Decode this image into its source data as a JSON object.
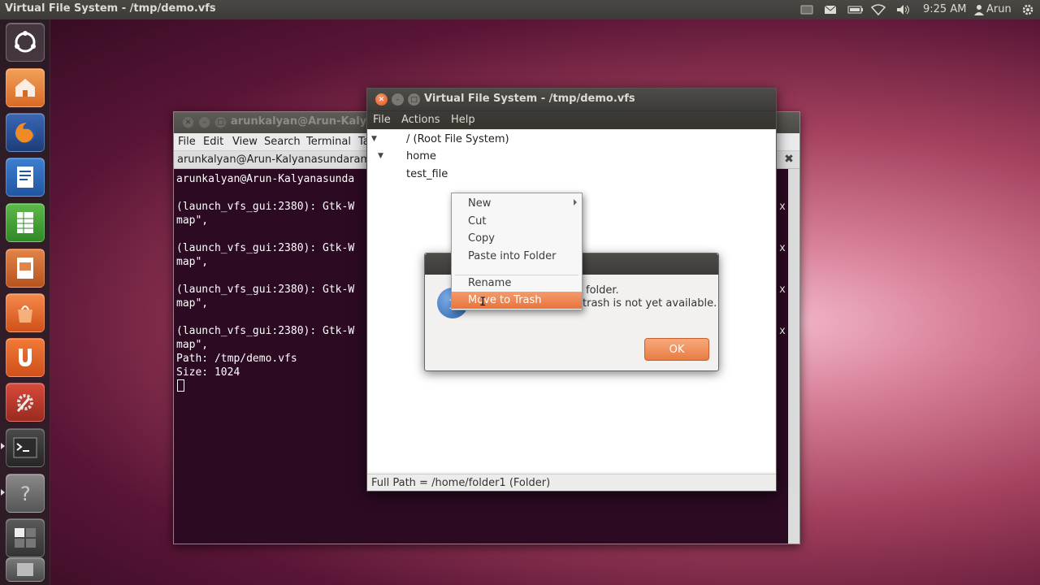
{
  "top_panel": {
    "title": "Virtual File System - /tmp/demo.vfs",
    "clock": "9:25 AM",
    "user": "Arun"
  },
  "terminal": {
    "title": "arunkalyan@Arun-Kalyan",
    "menu": [
      "File",
      "Edit",
      "View",
      "Search",
      "Terminal",
      "Ta"
    ],
    "tab_label": "arunkalyan@Arun-Kalyanasundaram:",
    "lines": [
      "arunkalyan@Arun-Kalyanasunda",
      "",
      "(launch_vfs_gui:2380): Gtk-W",
      "map\",",
      "",
      "(launch_vfs_gui:2380): Gtk-W",
      "map\",",
      "",
      "(launch_vfs_gui:2380): Gtk-W",
      "map\",",
      "",
      "(launch_vfs_gui:2380): Gtk-W",
      "map\",",
      "Path: /tmp/demo.vfs",
      "Size: 1024"
    ],
    "right_edge_chars": [
      "x",
      "x",
      "x",
      "x"
    ]
  },
  "vfs_window": {
    "title": "Virtual File System - /tmp/demo.vfs",
    "menu": [
      "File",
      "Actions",
      "Help"
    ],
    "tree": [
      "/ (Root File System)",
      "home",
      "test_file"
    ],
    "status": "Full Path = /home/folder1  (Folder)"
  },
  "dialog": {
    "line1": "folder.",
    "line2": "trash is not yet available.",
    "ok_label": "OK"
  },
  "context_menu": {
    "items": [
      "New",
      "Cut",
      "Copy",
      "Paste into Folder",
      "Rename",
      "Move to Trash"
    ]
  },
  "colors": {
    "accent": "#e9743c",
    "terminal_bg": "#2c0a22",
    "panel_bg": "#3c3b37"
  }
}
